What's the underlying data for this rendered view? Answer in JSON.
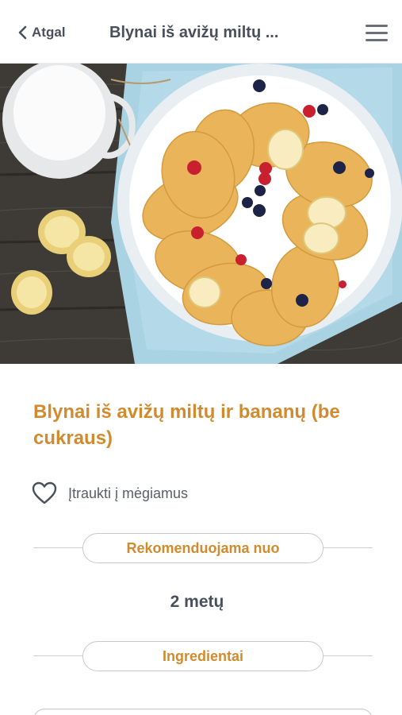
{
  "header": {
    "back_label": "Atgal",
    "title": "Blynai iš avižų miltų  ..."
  },
  "recipe": {
    "title": "Blynai iš avižų miltų ir bananų (be cukraus)",
    "favorite_label": "Įtraukti į mėgiamus",
    "recommended_label": "Rekomenduojama nuo",
    "recommended_value": "2 metų",
    "ingredients_label": "Ingredientai"
  },
  "colors": {
    "accent": "#d28a2e",
    "text": "#4a4f5c"
  },
  "icons": {
    "back": "chevron-left-icon",
    "menu": "hamburger-menu-icon",
    "favorite": "heart-outline-icon"
  }
}
